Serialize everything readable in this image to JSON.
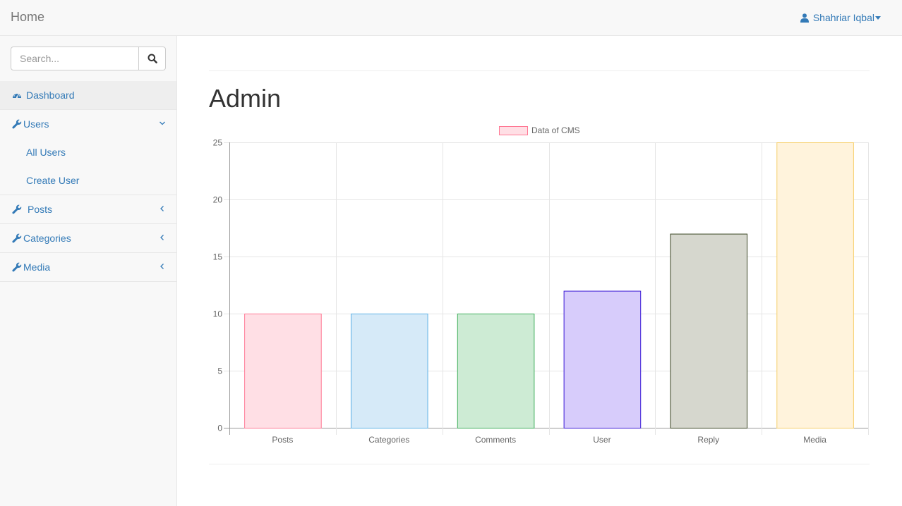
{
  "navbar": {
    "brand": "Home",
    "user_name": "Shahriar Iqbal"
  },
  "sidebar": {
    "search": {
      "placeholder": "Search...",
      "value": ""
    },
    "items": [
      {
        "label": "Dashboard",
        "icon": "dashboard-icon",
        "active": true
      },
      {
        "label": "Users",
        "icon": "wrench-icon",
        "expanded": true,
        "children": [
          {
            "label": "All Users"
          },
          {
            "label": "Create User"
          }
        ]
      },
      {
        "label": "Posts",
        "icon": "wrench-icon",
        "expanded": false
      },
      {
        "label": "Categories",
        "icon": "wrench-icon",
        "expanded": false
      },
      {
        "label": "Media",
        "icon": "wrench-icon",
        "expanded": false
      }
    ]
  },
  "main": {
    "title": "Admin"
  },
  "colors": {
    "link": "#337ab7",
    "navbar_bg": "#f8f8f8"
  },
  "chart_data": {
    "type": "bar",
    "legend": "Data of CMS",
    "legend_position": "top",
    "categories": [
      "Posts",
      "Categories",
      "Comments",
      "User",
      "Reply",
      "Media"
    ],
    "values": [
      10,
      10,
      10,
      12,
      17,
      25
    ],
    "ylim": [
      0,
      25
    ],
    "yticks": [
      0,
      5,
      10,
      15,
      20,
      25
    ],
    "grid": true,
    "bar_fills": [
      "#ffdfe5",
      "#d6eaf8",
      "#cdebd4",
      "#d7ccfb",
      "#d6d7ce",
      "#fff3dc"
    ],
    "bar_strokes": [
      "#ff7894",
      "#5eb2e6",
      "#3fae5b",
      "#3b1ad6",
      "#3b4524",
      "#f6cf6a"
    ],
    "legend_fill": "#ffdfe5",
    "legend_stroke": "#ff7894"
  }
}
